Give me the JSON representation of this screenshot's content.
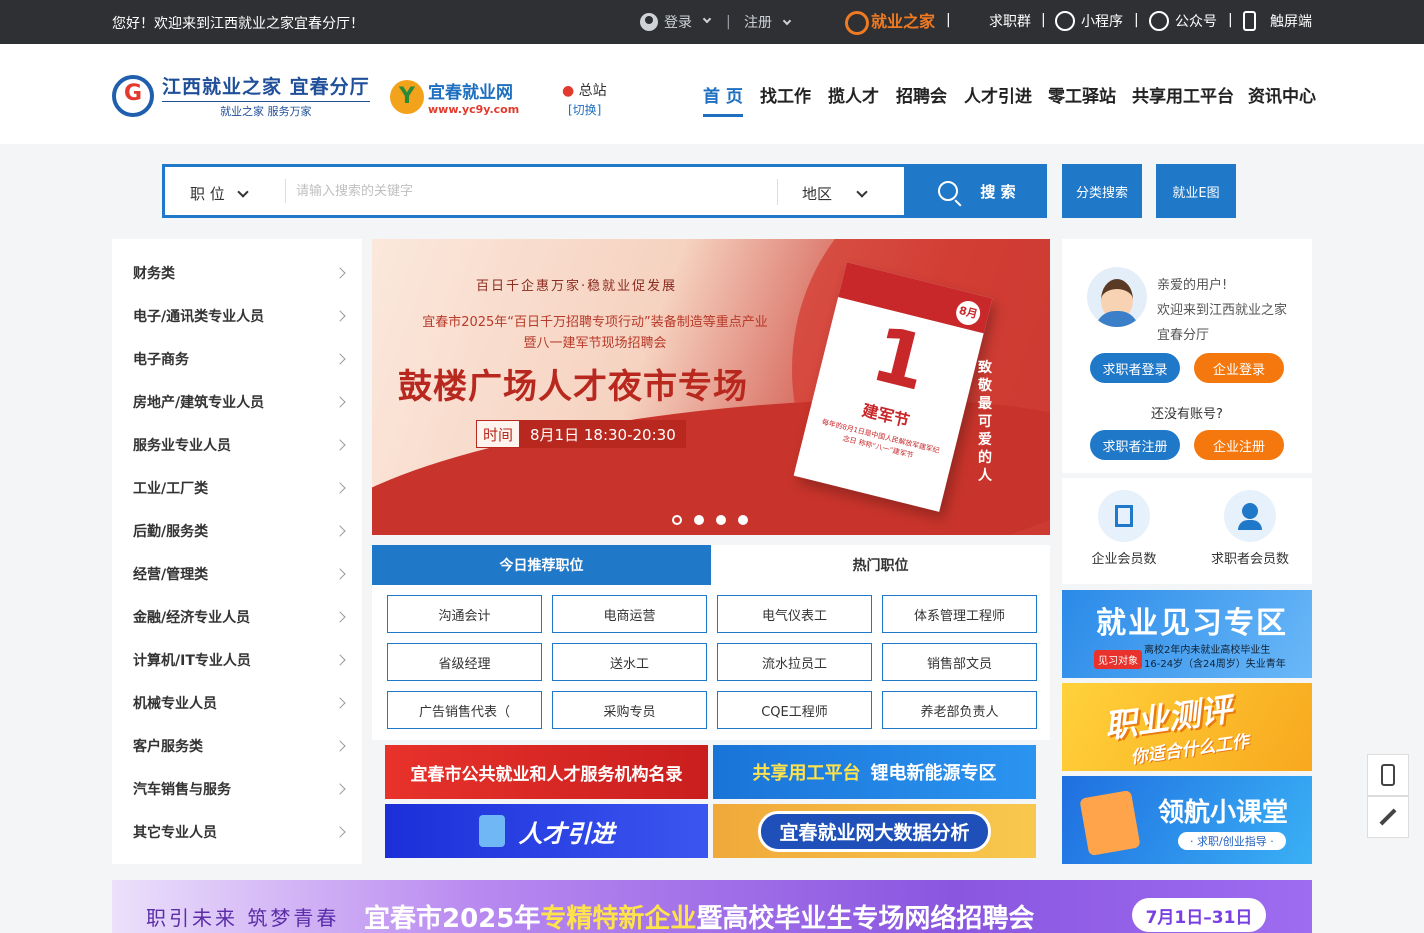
{
  "topbar": {
    "welcome": "您好！欢迎来到江西就业之家宜春分厅！",
    "login": "登录",
    "register": "注册",
    "brand": "就业之家",
    "links": [
      "求职群",
      "小程序",
      "公众号",
      "触屏端"
    ]
  },
  "header": {
    "logo1_title": "江西就业之家 宜春分厅",
    "logo1_slogan": "就业之家 服务万家",
    "logo2_name": "宜春就业网",
    "logo2_url": "www.yc9y.com",
    "station": "总站",
    "switch": "[切换]",
    "nav": [
      "首 页",
      "找工作",
      "揽人才",
      "招聘会",
      "人才引进",
      "零工驿站",
      "共享用工平台",
      "资讯中心"
    ]
  },
  "search": {
    "type": "职 位",
    "placeholder": "请输入搜索的关键字",
    "region": "地区",
    "button": "搜 索",
    "category_search": "分类搜索",
    "ebutton": "就业E图"
  },
  "categories": [
    "财务类",
    "电子/通讯类专业人员",
    "电子商务",
    "房地产/建筑专业人员",
    "服务业专业人员",
    "工业/工厂类",
    "后勤/服务类",
    "经营/管理类",
    "金融/经济专业人员",
    "计算机/IT专业人员",
    "机械专业人员",
    "客户服务类",
    "汽车销售与服务",
    "其它专业人员"
  ],
  "banner": {
    "subtitle": "百日千企惠万家·稳就业促发展",
    "line1": "宜春市2025年“百日千万招聘专项行动”装备制造等重点产业",
    "line2": "暨八一建军节现场招聘会",
    "title": "鼓楼广场人才夜市专场",
    "time_label": "时间",
    "time_value": "8月1日 18:30-20:30",
    "cal_day": "1",
    "cal_month": "8月",
    "cal_name": "建军节",
    "cal_note": "每年的8月1日是中国人民解放军建军纪念日 称称“八一”建军节",
    "side_text": "致敬最可爱的人"
  },
  "tabs": {
    "recommended": "今日推荐职位",
    "hot": "热门职位"
  },
  "jobs": [
    "沟通会计",
    "电商运营",
    "电气仪表工",
    "体系管理工程师",
    "省级经理",
    "送水工",
    "流水拉员工",
    "销售部文员",
    "广告销售代表（",
    "采购专员",
    "CQE工程师",
    "养老部负责人"
  ],
  "ads": {
    "public_service": "宜春市公共就业和人才服务机构名录",
    "share_platform": "共享用工平台",
    "lithium": "锂电新能源专区",
    "talent": "人才引进",
    "bigdata": "宜春就业网大数据分析"
  },
  "user": {
    "greet1": "亲爱的用户!",
    "greet2": "欢迎来到江西就业之家宜春分厅",
    "seeker_login": "求职者登录",
    "company_login": "企业登录",
    "no_account": "还没有账号?",
    "seeker_register": "求职者注册",
    "company_register": "企业注册",
    "stat_company": "企业会员数",
    "stat_seeker": "求职者会员数"
  },
  "right_banners": {
    "intern_title": "就业见习专区",
    "intern_tag": "见习对象",
    "intern_desc1": "离校2年内未就业高校毕业生",
    "intern_desc2": "16-24岁（含24周岁）失业青年",
    "assess_title": "职业测评",
    "assess_sub": "你适合什么工作",
    "class_title": "领航小课堂",
    "class_sub": "· 求职/创业指导 ·"
  },
  "bottom_banner": {
    "left": "职引未来 筑梦青春",
    "main_a": "宜春市2025年",
    "main_hl": "专精特新企业",
    "main_b": "暨高校毕业生专场网络招聘会",
    "date": "7月1日–31日"
  }
}
